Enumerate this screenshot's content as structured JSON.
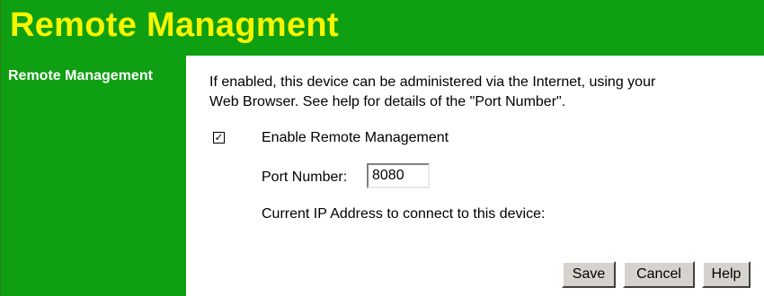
{
  "header": {
    "title": "Remote Managment"
  },
  "sidebar": {
    "section_label": "Remote Management"
  },
  "main": {
    "description_line1": "If enabled, this device can be administered via the Internet, using your",
    "description_line2": "Web Browser. See help for details of the \"Port Number\".",
    "enable_checkbox": {
      "checked": true,
      "label": "Enable Remote Management"
    },
    "port": {
      "label": "Port Number:",
      "value": "8080"
    },
    "ip_address_label": "Current IP Address to connect to this device:"
  },
  "buttons": {
    "save": "Save",
    "cancel": "Cancel",
    "help": "Help"
  },
  "colors": {
    "banner_bg": "#0f9f12",
    "title_text": "#f6f600",
    "sidebar_text": "#ffffff",
    "button_face": "#d6d3ce"
  },
  "icons": {
    "checkmark": "checkmark-icon"
  }
}
